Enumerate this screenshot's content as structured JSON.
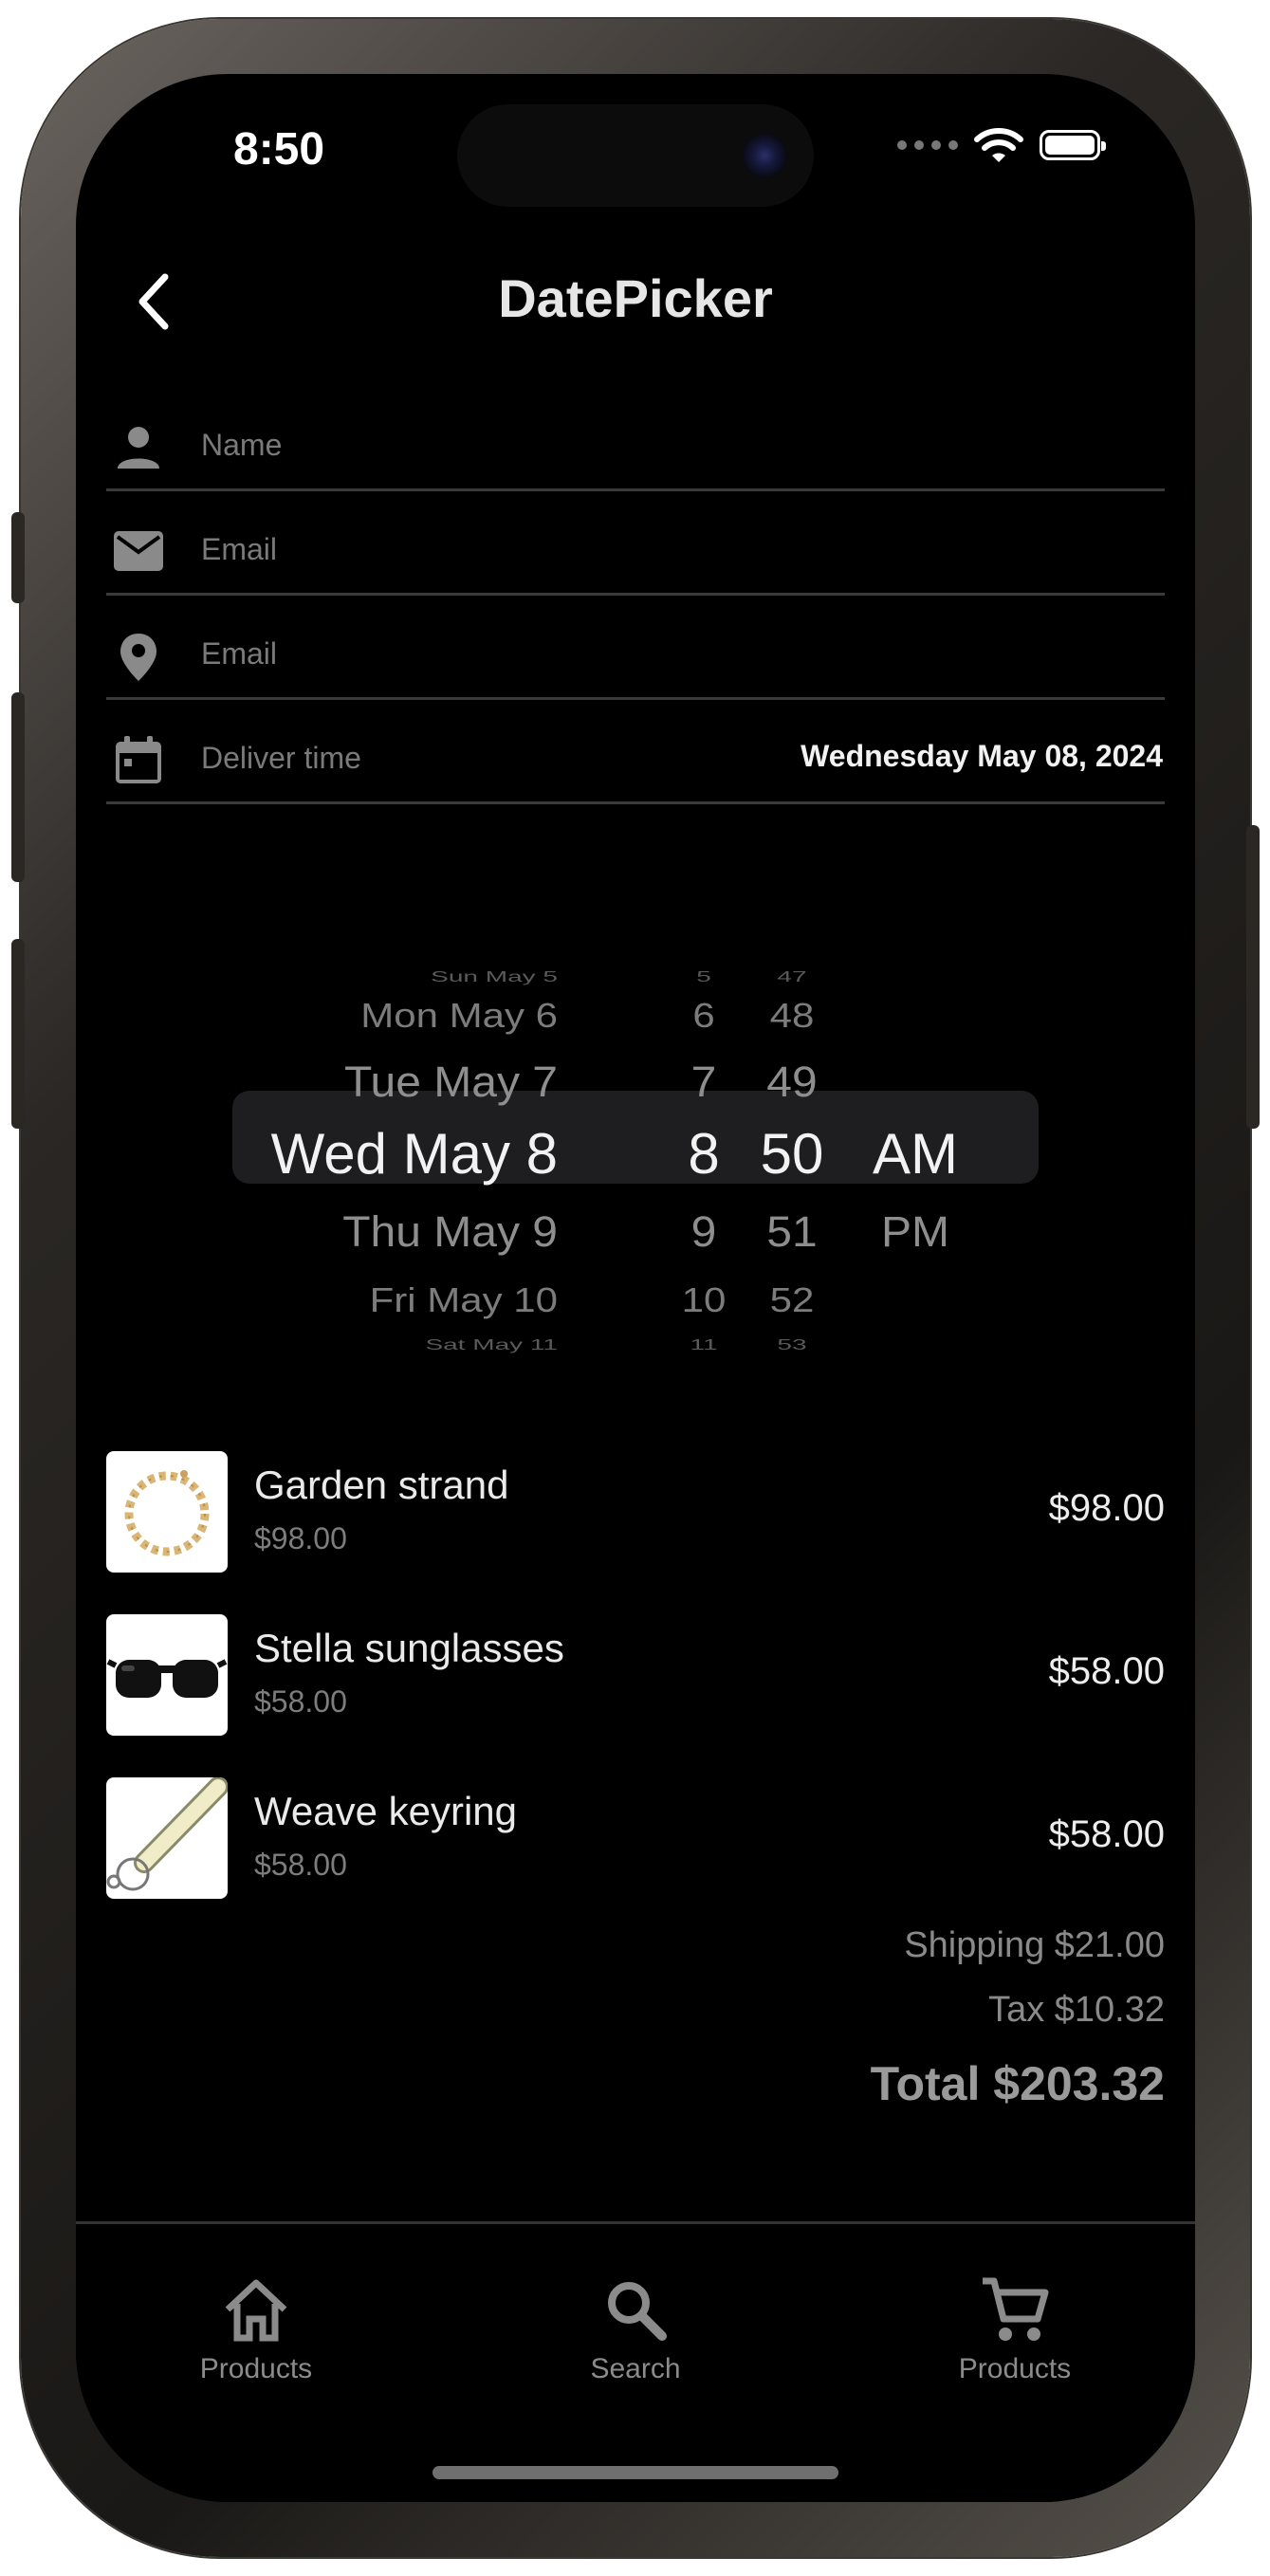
{
  "status_bar": {
    "time": "8:50"
  },
  "nav": {
    "title": "DatePicker"
  },
  "form": {
    "fields": [
      {
        "label": "Name",
        "icon": "person-icon"
      },
      {
        "label": "Email",
        "icon": "mail-icon"
      },
      {
        "label": "Email",
        "icon": "location-pin-icon"
      },
      {
        "label": "Deliver time",
        "icon": "calendar-icon",
        "value": "Wednesday May 08, 2024"
      }
    ]
  },
  "picker": {
    "dates": [
      "Sun May 5",
      "Mon May 6",
      "Tue May 7",
      "Wed May 8",
      "Thu May 9",
      "Fri May 10",
      "Sat May 11"
    ],
    "hours": [
      "5",
      "6",
      "7",
      "8",
      "9",
      "10",
      "11"
    ],
    "minutes": [
      "47",
      "48",
      "49",
      "50",
      "51",
      "52",
      "53"
    ],
    "ampm": [
      "AM",
      "PM"
    ],
    "selected": {
      "date": "Wed May 8",
      "hour": "8",
      "minute": "50",
      "ampm": "AM"
    }
  },
  "cart": {
    "items": [
      {
        "name": "Garden strand",
        "unit_price": "$98.00",
        "price": "$98.00",
        "image": "gold-chain-necklace"
      },
      {
        "name": "Stella sunglasses",
        "unit_price": "$58.00",
        "price": "$58.00",
        "image": "black-sunglasses"
      },
      {
        "name": "Weave keyring",
        "unit_price": "$58.00",
        "price": "$58.00",
        "image": "woven-keyring"
      }
    ],
    "shipping": "Shipping $21.00",
    "tax": "Tax $10.32",
    "total": "Total $203.32"
  },
  "tabbar": {
    "tabs": [
      {
        "label": "Products",
        "icon": "home-icon"
      },
      {
        "label": "Search",
        "icon": "search-icon"
      },
      {
        "label": "Products",
        "icon": "cart-icon"
      }
    ]
  },
  "colors": {
    "background": "#000000",
    "text": "#ffffff",
    "muted": "#7a7a7a",
    "divider": "#3a3a3a",
    "picker_highlight": "#1e1e20"
  }
}
